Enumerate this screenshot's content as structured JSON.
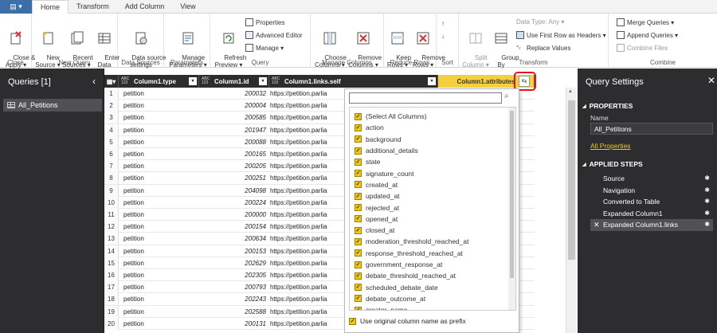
{
  "ribbon": {
    "file_label": "▤ ▾",
    "tabs": [
      "Home",
      "Transform",
      "Add Column",
      "View"
    ],
    "close": {
      "btn": "Close &\nApply ▾",
      "group": "Close"
    },
    "new_query": {
      "new_source": "New\nSource ▾",
      "recent_sources": "Recent\nSources ▾",
      "enter_data": "Enter\nData",
      "group": "New Query"
    },
    "data_sources": {
      "btn": "Data source\nsettings",
      "group": "Data Sources"
    },
    "parameters": {
      "btn": "Manage\nParameters ▾",
      "group": "Parameters"
    },
    "query": {
      "refresh": "Refresh\nPreview ▾",
      "properties": "Properties",
      "advanced_editor": "Advanced Editor",
      "manage": "Manage ▾",
      "group": "Query"
    },
    "manage_columns": {
      "choose": "Choose\nColumns ▾",
      "remove": "Remove\nColumns ▾",
      "group": "Manage Columns"
    },
    "reduce_rows": {
      "keep": "Keep\nRows ▾",
      "remove": "Remove\nRows ▾",
      "group": "Reduce Rows"
    },
    "sort": {
      "group": "Sort"
    },
    "transform": {
      "split": "Split\nColumn ▾",
      "group_by": "Group\nBy",
      "data_type": "Data Type: Any ▾",
      "first_row": "Use First Row as Headers ▾",
      "replace": "Replace Values",
      "group": "Transform"
    },
    "combine": {
      "merge": "Merge Queries ▾",
      "append": "Append Queries ▾",
      "files": "Combine Files",
      "group": "Combine"
    }
  },
  "queries_pane": {
    "title": "Queries [1]",
    "collapse": "‹",
    "items": [
      "All_Petitions"
    ]
  },
  "grid": {
    "columns": [
      {
        "type": "ABC\n123",
        "name": "Column1.type"
      },
      {
        "type": "ABC\n123",
        "name": "Column1.id"
      },
      {
        "type": "ABC\n123",
        "name": "Column1.links.self"
      },
      {
        "type": "",
        "name": "Column1.attributes"
      }
    ],
    "expand_icon": "⇆",
    "rows": [
      {
        "n": "1",
        "type": "petition",
        "id": "200032",
        "link": "https://petition.parlia"
      },
      {
        "n": "2",
        "type": "petition",
        "id": "200004",
        "link": "https://petition.parlia"
      },
      {
        "n": "3",
        "type": "petition",
        "id": "200585",
        "link": "https://petition.parlia"
      },
      {
        "n": "4",
        "type": "petition",
        "id": "201947",
        "link": "https://petition.parlia"
      },
      {
        "n": "5",
        "type": "petition",
        "id": "200088",
        "link": "https://petition.parlia"
      },
      {
        "n": "6",
        "type": "petition",
        "id": "200165",
        "link": "https://petition.parlia"
      },
      {
        "n": "7",
        "type": "petition",
        "id": "200205",
        "link": "https://petition.parlia"
      },
      {
        "n": "8",
        "type": "petition",
        "id": "200251",
        "link": "https://petition.parlia"
      },
      {
        "n": "9",
        "type": "petition",
        "id": "204098",
        "link": "https://petition.parlia"
      },
      {
        "n": "10",
        "type": "petition",
        "id": "200224",
        "link": "https://petition.parlia"
      },
      {
        "n": "11",
        "type": "petition",
        "id": "200000",
        "link": "https://petition.parlia"
      },
      {
        "n": "12",
        "type": "petition",
        "id": "200154",
        "link": "https://petition.parlia"
      },
      {
        "n": "13",
        "type": "petition",
        "id": "200634",
        "link": "https://petition.parlia"
      },
      {
        "n": "14",
        "type": "petition",
        "id": "200153",
        "link": "https://petition.parlia"
      },
      {
        "n": "15",
        "type": "petition",
        "id": "202629",
        "link": "https://petition.parlia"
      },
      {
        "n": "16",
        "type": "petition",
        "id": "202305",
        "link": "https://petition.parlia"
      },
      {
        "n": "17",
        "type": "petition",
        "id": "200793",
        "link": "https://petition.parlia"
      },
      {
        "n": "18",
        "type": "petition",
        "id": "202243",
        "link": "https://petition.parlia"
      },
      {
        "n": "19",
        "type": "petition",
        "id": "202588",
        "link": "https://petition.parlia"
      },
      {
        "n": "20",
        "type": "petition",
        "id": "200131",
        "link": "https://petition.parlia"
      }
    ]
  },
  "dropdown": {
    "search_value": "",
    "search_icon": "⌕",
    "options": [
      {
        "label": "(Select All Columns)",
        "checked": true
      },
      {
        "label": "action",
        "checked": true
      },
      {
        "label": "background",
        "checked": true
      },
      {
        "label": "additional_details",
        "checked": true
      },
      {
        "label": "state",
        "checked": true
      },
      {
        "label": "signature_count",
        "checked": true
      },
      {
        "label": "created_at",
        "checked": true
      },
      {
        "label": "updated_at",
        "checked": true
      },
      {
        "label": "rejected_at",
        "checked": true
      },
      {
        "label": "opened_at",
        "checked": true
      },
      {
        "label": "closed_at",
        "checked": true
      },
      {
        "label": "moderation_threshold_reached_at",
        "checked": true
      },
      {
        "label": "response_threshold_reached_at",
        "checked": true
      },
      {
        "label": "government_response_at",
        "checked": true
      },
      {
        "label": "debate_threshold_reached_at",
        "checked": true
      },
      {
        "label": "scheduled_debate_date",
        "checked": true
      },
      {
        "label": "debate_outcome_at",
        "checked": true
      },
      {
        "label": "creator_name",
        "checked": true
      }
    ],
    "prefix_label": "Use original column name as prefix",
    "prefix_checked": true
  },
  "settings": {
    "title": "Query Settings",
    "close": "✕",
    "properties_header": "PROPERTIES",
    "name_label": "Name",
    "name_value": "All_Petitions",
    "all_properties": "All Properties",
    "applied_steps_header": "APPLIED STEPS",
    "steps": [
      "Source",
      "Navigation",
      "Converted to Table",
      "Expanded Column1",
      "Expanded Column1.links"
    ],
    "selected_step": 4
  },
  "colors": {
    "accent": "#f2c811",
    "highlight": "#e3141a",
    "dark_pane": "#2d2d30",
    "file_tab": "#3c6ea8"
  }
}
